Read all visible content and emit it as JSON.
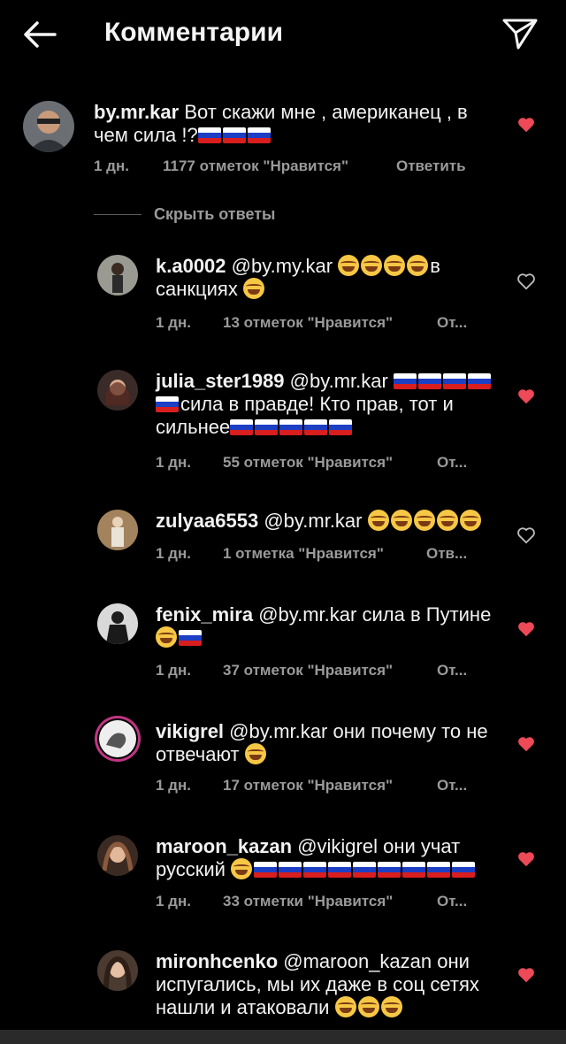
{
  "header": {
    "title": "Комментарии"
  },
  "main_comment": {
    "username": "by.mr.kar",
    "text": "Вот скажи мне , американец , в чем сила !?",
    "flags": 3,
    "time": "1 дн.",
    "likes": "1177 отметок \"Нравится\"",
    "reply": "Ответить",
    "liked": true
  },
  "hide_replies": "Скрыть ответы",
  "replies": [
    {
      "username": "k.a0002",
      "mention": "@by.my.kar",
      "text": "в санкциях",
      "time": "1 дн.",
      "likes": "13 отметок \"Нравится\"",
      "reply": "От...",
      "liked": false
    },
    {
      "username": "julia_ster1989",
      "mention": "@by.mr.kar",
      "text": "сила в правде! Кто прав, тот и сильнее",
      "time": "1 дн.",
      "likes": "55 отметок \"Нравится\"",
      "reply": "От...",
      "liked": true
    },
    {
      "username": "zulyaa6553",
      "mention": "@by.mr.kar",
      "text": "",
      "time": "1 дн.",
      "likes": "1 отметка \"Нравится\"",
      "reply": "Отв...",
      "liked": false
    },
    {
      "username": "fenix_mira",
      "mention": "@by.mr.kar",
      "text": "сила в Путине",
      "time": "1 дн.",
      "likes": "37 отметок \"Нравится\"",
      "reply": "От...",
      "liked": true
    },
    {
      "username": "vikigrel",
      "mention": "@by.mr.kar",
      "text": "они почему то не отвечают",
      "time": "1 дн.",
      "likes": "17 отметок \"Нравится\"",
      "reply": "От...",
      "liked": true
    },
    {
      "username": "maroon_kazan",
      "mention": "@vikigrel",
      "text": "они учат русский",
      "time": "1 дн.",
      "likes": "33 отметки \"Нравится\"",
      "reply": "От...",
      "liked": true
    },
    {
      "username": "mironhcenko",
      "mention": "@maroon_kazan",
      "text": "они испугались, мы их даже в соц сетях нашли и атаковали",
      "time": "",
      "likes": "",
      "reply": "",
      "liked": true
    }
  ],
  "colors": {
    "background": "#000000",
    "heart_active": "#ed4956",
    "meta": "#9a9a9a"
  }
}
